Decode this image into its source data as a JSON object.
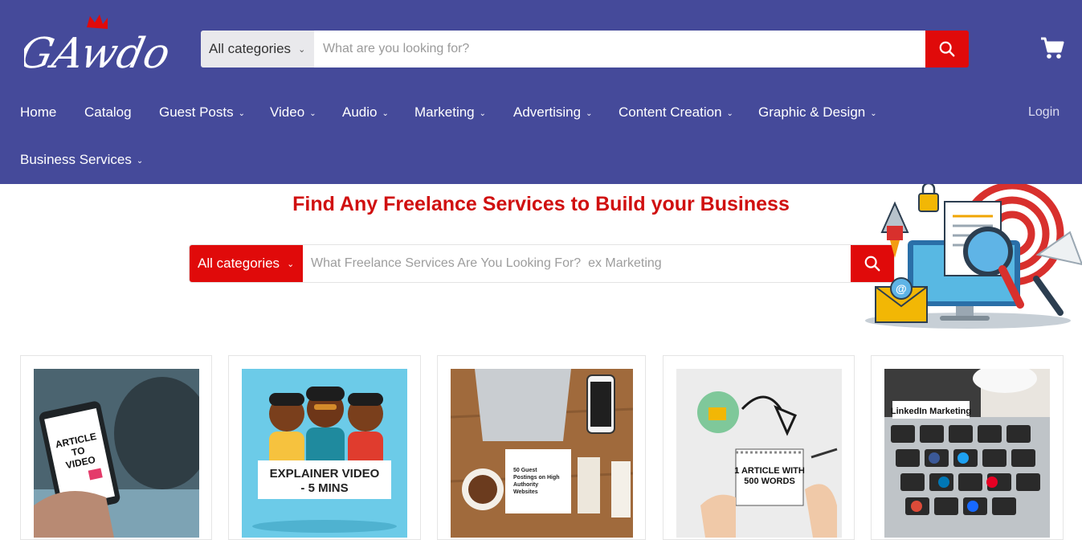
{
  "brand": {
    "logo_text": "GAwdo",
    "accent": "#e00a0a",
    "header_bg": "#454a9a"
  },
  "search_top": {
    "category": "All categories",
    "placeholder": "What are you looking for?",
    "icon": "search-icon"
  },
  "cart": {
    "icon": "cart-icon"
  },
  "nav": {
    "home": "Home",
    "catalog": "Catalog",
    "guest_posts": "Guest Posts",
    "video": "Video",
    "audio": "Audio",
    "marketing": "Marketing",
    "advertising": "Advertising",
    "content_creation": "Content Creation",
    "graphic_design": "Graphic & Design",
    "business_services": "Business Services",
    "login": "Login"
  },
  "hero": {
    "title": "Find Any Freelance Services to Build your Business",
    "search_category": "All categories",
    "search_placeholder": "What Freelance Services Are You Looking For?  ex Marketing"
  },
  "products": [
    {
      "image_text": [
        "ARTICLE",
        "TO",
        "VIDEO"
      ]
    },
    {
      "image_text": [
        "EXPLAINER VIDEO",
        "- 5 MINS"
      ]
    },
    {
      "image_text": [
        "50 Guest",
        "Postings on High",
        "Authority",
        "Websites"
      ]
    },
    {
      "image_text": [
        "1 ARTICLE WITH",
        "500 WORDS"
      ]
    },
    {
      "image_text": [
        "LinkedIn Marketing"
      ]
    }
  ]
}
